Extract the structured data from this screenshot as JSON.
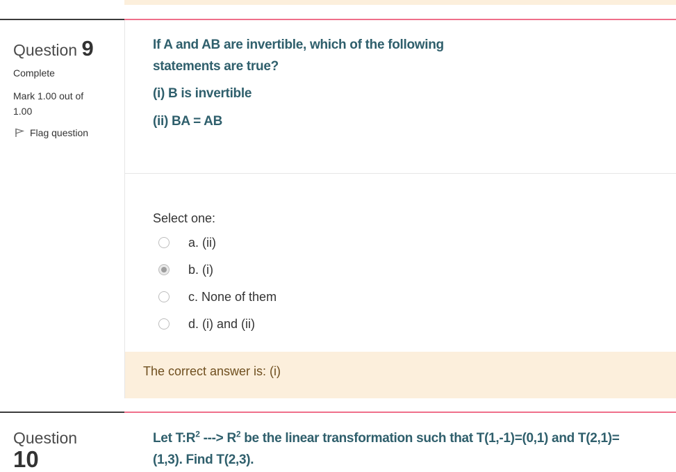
{
  "q9": {
    "label": "Question",
    "number": "9",
    "state": "Complete",
    "grade": "Mark 1.00 out of 1.00",
    "flag_label": "Flag question",
    "text_line1": "If A and AB are invertible, which of the following",
    "text_line2": "statements are true?",
    "stmt1": "(i) B is invertible",
    "stmt2": "(ii) BA = AB",
    "prompt": "Select one:",
    "options": [
      {
        "label": "a. (ii)",
        "selected": false
      },
      {
        "label": "b. (i)",
        "selected": true
      },
      {
        "label": "c. None of them",
        "selected": false
      },
      {
        "label": "d. (i) and (ii)",
        "selected": false
      }
    ],
    "feedback": "The correct answer is: (i)"
  },
  "q10": {
    "label": "Question",
    "number": "10",
    "text_line1_a": "Let T:R",
    "text_line1_sup1": "2",
    "text_line1_b": " ---> R",
    "text_line1_sup2": "2",
    "text_line1_c": " be the linear transformation such that T(1,-1)=(0,1) and T(2,1)=",
    "text_line2": "(1,3). Find T(2,3)."
  },
  "colors": {
    "question_text": "#2f5f6c",
    "separator_accent": "#ef6f8a",
    "feedback_bg": "#fcefdc"
  }
}
